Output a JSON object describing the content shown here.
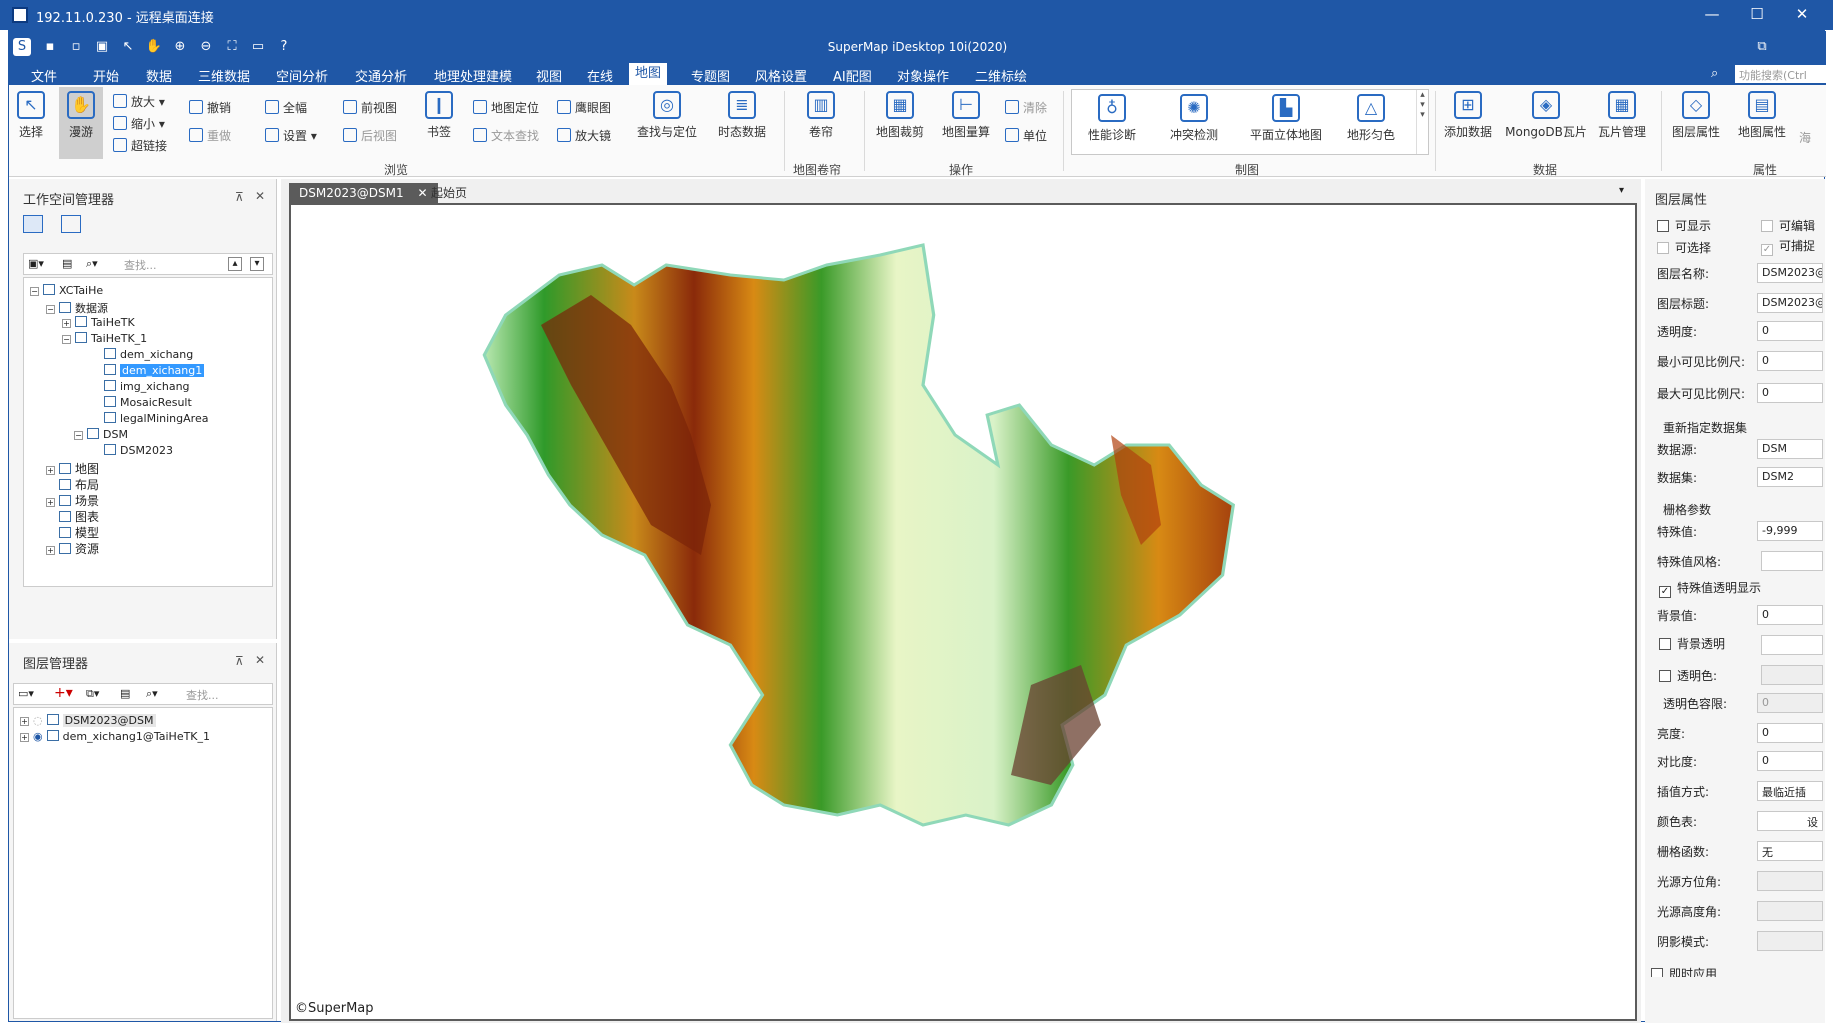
{
  "rdp": {
    "title": "192.11.0.230 - 远程桌面连接",
    "minimize": "—",
    "maximize": "☐",
    "close": "✕"
  },
  "app": {
    "title": "SuperMap iDesktop 10i(2020)"
  },
  "menu": {
    "tabs": [
      "文件",
      "开始",
      "数据",
      "三维数据",
      "空间分析",
      "交通分析",
      "地理处理建模",
      "视图",
      "在线",
      "地图",
      "专题图",
      "风格设置",
      "AI配图",
      "对象操作",
      "二维标绘"
    ],
    "active": "地图",
    "search_placeholder": "功能搜索(Ctrl"
  },
  "ribbon": {
    "browse": {
      "select": "选择",
      "pan": "漫游",
      "zoom_in": "放大",
      "zoom_out": "缩小",
      "hyperlink": "超链接",
      "undo": "撤销",
      "redo": "重做",
      "full_extent": "全幅",
      "settings": "设置",
      "prev_view": "前视图",
      "next_view": "后视图",
      "bookmark": "书签",
      "map_locate": "地图定位",
      "text_search": "文本查找",
      "eagle_eye": "鹰眼图",
      "magnifier": "放大镜",
      "find_locate": "查找与定位",
      "temporal_data": "时态数据",
      "group": "浏览"
    },
    "swipe": {
      "swipe": "卷帘",
      "group": "地图卷帘"
    },
    "ops": {
      "map_clip": "地图裁剪",
      "map_measure": "地图量算",
      "clear": "清除",
      "unit": "单位",
      "group": "操作"
    },
    "cartography": {
      "perf_diag": "性能诊断",
      "conflict_check": "冲突检测",
      "plan_3d_map": "平面立体地图",
      "terrain_color": "地形匀色",
      "group": "制图"
    },
    "data": {
      "add_data": "添加数据",
      "mongodb_tile": "MongoDB瓦片",
      "tile_manage": "瓦片管理",
      "group": "数据"
    },
    "attr": {
      "layer_props": "图层属性",
      "map_props": "地图属性",
      "more": "海",
      "group": "属性"
    }
  },
  "workspace": {
    "title": "工作空间管理器",
    "search_placeholder": "查找...",
    "tree": {
      "root": "XCTaiHe",
      "datasources": "数据源",
      "ds1": "TaiHeTK",
      "ds2": "TaiHeTK_1",
      "items": [
        "dem_xichang",
        "dem_xichang1",
        "img_xichang",
        "MosaicResult",
        "legalMiningArea"
      ],
      "ds3": "DSM",
      "ds3_item": "DSM2023",
      "maps": "地图",
      "layouts": "布局",
      "scenes": "场景",
      "charts": "图表",
      "models": "模型",
      "resources": "资源"
    }
  },
  "layers": {
    "title": "图层管理器",
    "search_placeholder": "查找...",
    "items": [
      "DSM2023@DSM",
      "dem_xichang1@TaiHeTK_1"
    ]
  },
  "map": {
    "tabs": [
      "DSM2023@DSM1",
      "起始页"
    ],
    "active_tab": "DSM2023@DSM1",
    "copyright": "©SuperMap"
  },
  "props": {
    "title": "图层属性",
    "visible": "可显示",
    "editable": "可编辑",
    "selectable": "可选择",
    "snappable": "可捕捉",
    "layer_name_label": "图层名称:",
    "layer_name": "DSM2023@",
    "layer_caption_label": "图层标题:",
    "layer_caption": "DSM2023@",
    "transparency_label": "透明度:",
    "transparency": "0",
    "min_scale_label": "最小可见比例尺:",
    "min_scale": "0",
    "max_scale_label": "最大可见比例尺:",
    "max_scale": "0",
    "redirect_title": "重新指定数据集",
    "datasource_label": "数据源:",
    "datasource": "DSM",
    "dataset_label": "数据集:",
    "dataset": "DSM2",
    "grid_title": "栅格参数",
    "nodata_label": "特殊值:",
    "nodata": "-9,999",
    "nodata_style_label": "特殊值风格:",
    "nodata_transparent": "特殊值透明显示",
    "background_label": "背景值:",
    "background": "0",
    "bg_transparent": "背景透明",
    "transparent_color": "透明色:",
    "color_tolerance_label": "透明色容限:",
    "color_tolerance": "0",
    "brightness_label": "亮度:",
    "brightness": "0",
    "contrast_label": "对比度:",
    "contrast": "0",
    "interp_label": "插值方式:",
    "interp": "最临近插",
    "colortable_label": "颜色表:",
    "colortable_btn": "设",
    "grid_func_label": "栅格函数:",
    "grid_func": "无",
    "azimuth_label": "光源方位角:",
    "altitude_label": "光源高度角:",
    "shadow_label": "阴影模式:",
    "realtime": "即时应用"
  },
  "colors": {
    "title_blue": "#1f57a6",
    "accent": "#2a6bc2"
  }
}
